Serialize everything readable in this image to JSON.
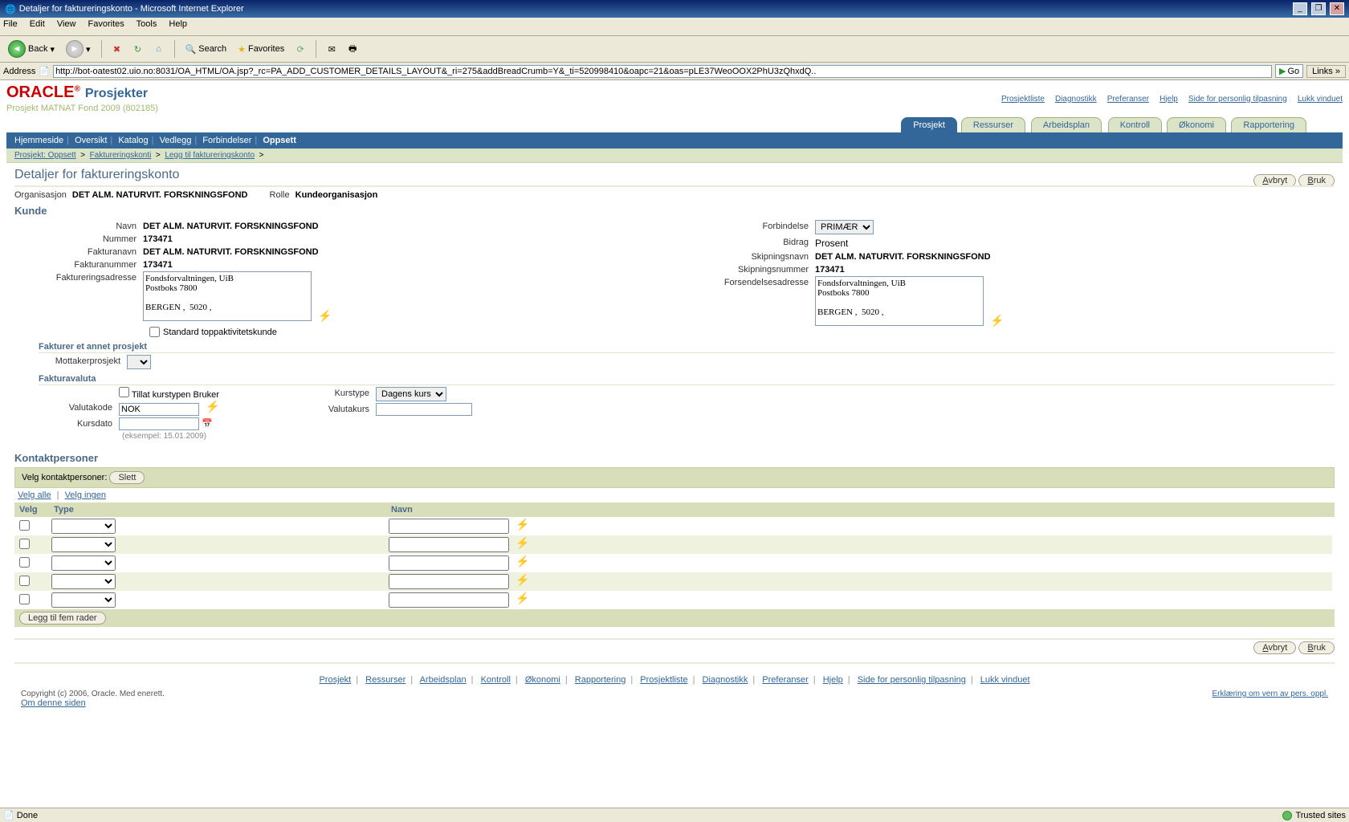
{
  "window": {
    "title": "Detaljer for faktureringskonto - Microsoft Internet Explorer"
  },
  "ie": {
    "menu": [
      "File",
      "Edit",
      "View",
      "Favorites",
      "Tools",
      "Help"
    ],
    "back": "Back",
    "search": "Search",
    "favorites": "Favorites",
    "address_label": "Address",
    "address": "http://bot-oatest02.uio.no:8031/OA_HTML/OA.jsp?_rc=PA_ADD_CUSTOMER_DETAILS_LAYOUT&_ri=275&addBreadCrumb=Y&_ti=520998410&oapc=21&oas=pLE37WeoOOX2PhU3zQhxdQ..",
    "go": "Go",
    "links": "Links"
  },
  "brand": {
    "title": "Prosjekter",
    "subtitle": "Prosjekt MATNAT Fond 2009 (802185)"
  },
  "toplinks": [
    "Prosjektliste",
    "Diagnostikk",
    "Preferanser",
    "Hjelp",
    "Side for personlig tilpasning",
    "Lukk vinduet"
  ],
  "tabs": [
    {
      "label": "Prosjekt",
      "active": true
    },
    {
      "label": "Ressurser"
    },
    {
      "label": "Arbeidsplan"
    },
    {
      "label": "Kontroll"
    },
    {
      "label": "Økonomi"
    },
    {
      "label": "Rapportering"
    }
  ],
  "subnav": [
    "Hjemmeside",
    "Oversikt",
    "Katalog",
    "Vedlegg",
    "Forbindelser",
    "Oppsett"
  ],
  "breadcrumb": [
    {
      "label": "Prosjekt: Oppsett",
      "link": true
    },
    {
      "label": "Faktureringskonti",
      "link": true
    },
    {
      "label": "Legg til faktureringskonto",
      "link": true
    }
  ],
  "page": {
    "title": "Detaljer for faktureringskonto",
    "org_label": "Organisasjon",
    "org": "DET ALM. NATURVIT. FORSKNINGSFOND",
    "role_label": "Rolle",
    "role": "Kundeorganisasjon"
  },
  "buttons": {
    "cancel": "Avbryt",
    "apply": "Bruk",
    "apply_u": "B",
    "apply_rest": "ruk",
    "cancel_u": "A",
    "cancel_rest": "vbryt"
  },
  "kunde": {
    "section": "Kunde",
    "navn_label": "Navn",
    "navn": "DET ALM. NATURVIT. FORSKNINGSFOND",
    "nummer_label": "Nummer",
    "nummer": "173471",
    "fakturanavn_label": "Fakturanavn",
    "fakturanavn": "DET ALM. NATURVIT. FORSKNINGSFOND",
    "fakturanummer_label": "Fakturanummer",
    "fakturanummer": "173471",
    "fadresse_label": "Faktureringsadresse",
    "fadresse": "Fondsforvaltningen, UiB\nPostboks 7800\n\nBERGEN ,  5020 ,",
    "std_label": "Standard toppaktivitetskunde",
    "forbindelse_label": "Forbindelse",
    "forbindelse": "PRIMÆR",
    "bidrag_label": "Bidrag",
    "bidrag": "Prosent",
    "skipnavn_label": "Skipningsnavn",
    "skipnavn": "DET ALM. NATURVIT. FORSKNINGSFOND",
    "skipnr_label": "Skipningsnummer",
    "skipnr": "173471",
    "forsadr_label": "Forsendelsesadresse",
    "forsadr": "Fondsforvaltningen, UiB\nPostboks 7800\n\nBERGEN ,  5020 ,"
  },
  "annet": {
    "section": "Fakturer et annet prosjekt",
    "mottaker_label": "Mottakerprosjekt"
  },
  "valuta": {
    "section": "Fakturavaluta",
    "tillat_label": "Tillat kurstypen Bruker",
    "kode_label": "Valutakode",
    "kode": "NOK",
    "dato_label": "Kursdato",
    "hint": "(eksempel: 15.01.2009)",
    "kurstype_label": "Kurstype",
    "kurstype": "Dagens kurs",
    "valutakurs_label": "Valutakurs"
  },
  "kontakt": {
    "section": "Kontaktpersoner",
    "velg_label": "Velg kontaktpersoner:",
    "slett": "Slett",
    "velg_alle": "Velg alle",
    "velg_ingen": "Velg ingen",
    "th_velg": "Velg",
    "th_type": "Type",
    "th_navn": "Navn",
    "legg_til": "Legg til fem rader"
  },
  "footer": {
    "links": [
      "Prosjekt",
      "Ressurser",
      "Arbeidsplan",
      "Kontroll",
      "Økonomi",
      "Rapportering",
      "Prosjektliste",
      "Diagnostikk",
      "Preferanser",
      "Hjelp",
      "Side for personlig tilpasning",
      "Lukk vinduet"
    ],
    "copyright": "Copyright (c) 2006, Oracle. Med enerett.",
    "om": "Om denne siden",
    "erkl": "Erklæring om vern av pers. oppl."
  },
  "status": {
    "done": "Done",
    "trusted": "Trusted sites"
  }
}
